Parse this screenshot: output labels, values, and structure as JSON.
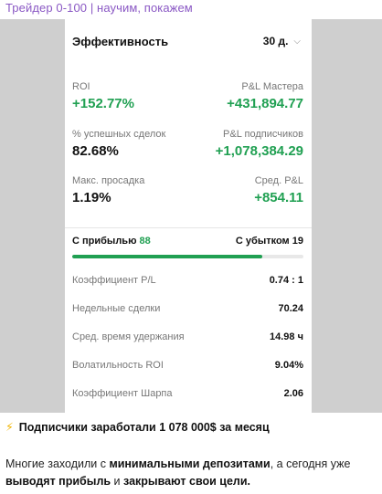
{
  "channel": {
    "title": "Трейдер 0-100 | научим, покажем"
  },
  "card": {
    "title": "Эффективность",
    "period": "30 д.",
    "stats": [
      {
        "label": "ROI",
        "value": "+152.77%",
        "align": "left",
        "color": "green"
      },
      {
        "label": "P&L Мастера",
        "value": "+431,894.77",
        "align": "right",
        "color": "green"
      },
      {
        "label": "% успешных сделок",
        "value": "82.68%",
        "align": "left",
        "color": "dark"
      },
      {
        "label": "P&L подписчиков",
        "value": "+1,078,384.29",
        "align": "right",
        "color": "green"
      },
      {
        "label": "Макс. просадка",
        "value": "1.19%",
        "align": "left",
        "color": "dark"
      },
      {
        "label": "Сред. P&L",
        "value": "+854.11",
        "align": "right",
        "color": "green"
      }
    ],
    "profit_label": "С прибылью",
    "profit_count": "88",
    "loss_label": "С убытком",
    "loss_count": "19",
    "profit_share": 0.8224,
    "metrics": [
      {
        "label": "Коэффициент P/L",
        "value": "0.74 : 1"
      },
      {
        "label": "Недельные сделки",
        "value": "70.24"
      },
      {
        "label": "Сред. время удержания",
        "value": "14.98 ч"
      },
      {
        "label": "Волатильность ROI",
        "value": "9.04%"
      },
      {
        "label": "Коэффициент Шарпа",
        "value": "2.06"
      }
    ]
  },
  "post": {
    "headline_icon": "⚡",
    "headline": "Подписчики заработали 1 078 000$ за месяц",
    "body_parts": [
      {
        "text": "Многие заходили с ",
        "bold": false
      },
      {
        "text": "минимальными депозитами",
        "bold": true
      },
      {
        "text": ", а сегодня уже ",
        "bold": false
      },
      {
        "text": "выводят прибыль",
        "bold": true
      },
      {
        "text": " и ",
        "bold": false
      },
      {
        "text": "закрывают свои цели.",
        "bold": true
      }
    ]
  },
  "colors": {
    "green": "#20a052",
    "channel": "#8a58c4",
    "bar_track": "#e8e8e8"
  }
}
